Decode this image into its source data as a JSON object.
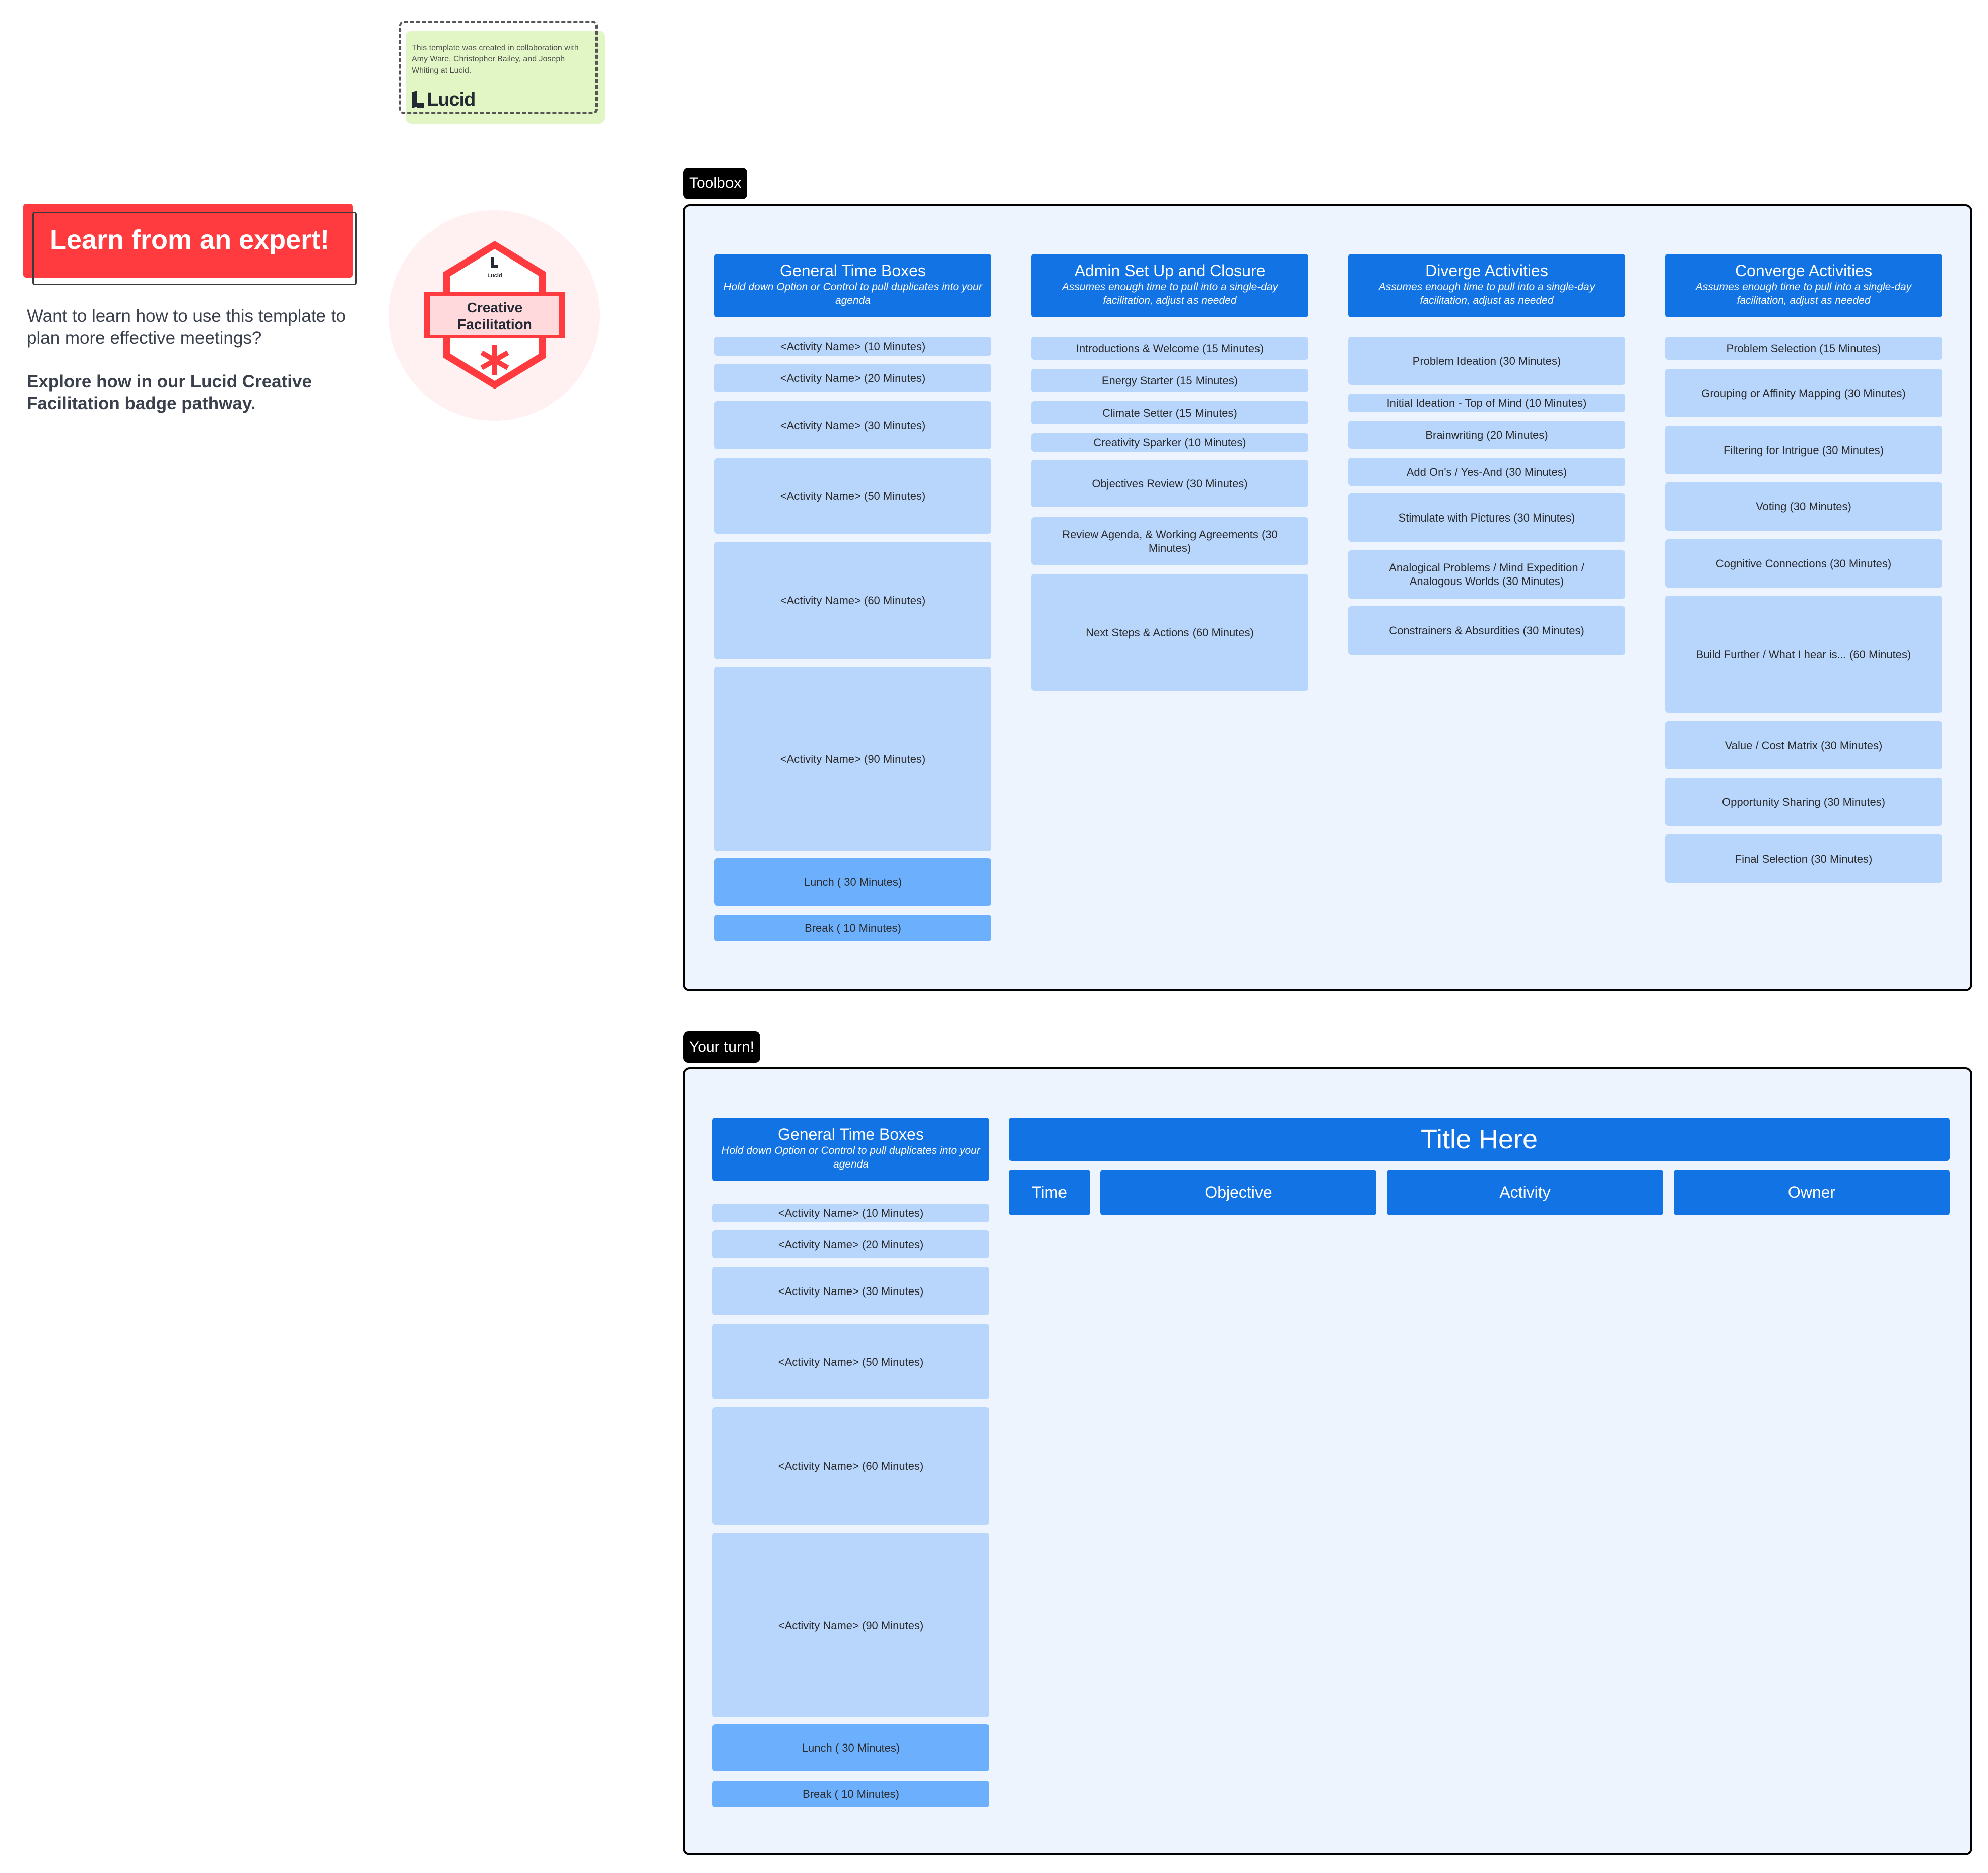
{
  "credit": {
    "text": "This template was created in collaboration with Amy Ware, Christopher Bailey, and Joseph Whiting at Lucid.",
    "logo_text": "Lucid"
  },
  "promo": {
    "button_label": "Learn from an expert!",
    "question": "Want to learn how to use this template to plan more effective meetings?",
    "cta": "Explore how in our Lucid Creative Facilitation badge pathway.",
    "accent_color": "#ff3b3f"
  },
  "badge": {
    "brand": "Lucid",
    "line1": "Creative",
    "line2": "Facilitation"
  },
  "toolbox": {
    "tag": "Toolbox",
    "columns": [
      {
        "title": "General Time Boxes",
        "subtitle": "Hold down Option or Control to pull duplicates into your agenda",
        "items": [
          "<Activity Name> (10 Minutes)",
          "<Activity Name> (20 Minutes)",
          "<Activity Name>  (30 Minutes)",
          "<Activity Name>  (50 Minutes)",
          "<Activity Name> (60 Minutes)",
          "<Activity Name> (90 Minutes)",
          "Lunch ( 30 Minutes)",
          "Break ( 10 Minutes)"
        ]
      },
      {
        "title": "Admin Set Up and Closure",
        "subtitle": "Assumes enough time to pull into a single-day facilitation, adjust as needed",
        "items": [
          "Introductions & Welcome (15 Minutes)",
          "Energy Starter (15 Minutes)",
          "Climate Setter (15 Minutes)",
          "Creativity Sparker (10 Minutes)",
          "Objectives Review (30 Minutes)",
          "Review Agenda, & Working Agreements (30 Minutes)",
          "Next Steps & Actions (60 Minutes)"
        ]
      },
      {
        "title": "Diverge Activities",
        "subtitle": "Assumes enough time to pull into a single-day facilitation, adjust as needed",
        "items": [
          "Problem Ideation (30 Minutes)",
          "Initial Ideation - Top of Mind (10 Minutes)",
          "Brainwriting (20 Minutes)",
          "Add On's / Yes-And (30 Minutes)",
          "Stimulate with Pictures (30 Minutes)",
          "Analogical Problems / Mind Expedition / Analogous Worlds (30 Minutes)",
          "Constrainers & Absurdities (30 Minutes)"
        ]
      },
      {
        "title": "Converge Activities",
        "subtitle": "Assumes enough time to pull into a single-day facilitation, adjust as needed",
        "items": [
          "Problem Selection (15 Minutes)",
          "Grouping or Affinity Mapping (30 Minutes)",
          "Filtering for Intrigue (30 Minutes)",
          "Voting (30 Minutes)",
          "Cognitive Connections (30 Minutes)",
          "Build Further / What I hear is... (60 Minutes)",
          "Value / Cost Matrix (30 Minutes)",
          "Opportunity Sharing (30 Minutes)",
          "Final Selection (30 Minutes)"
        ]
      }
    ]
  },
  "your_turn": {
    "tag": "Your turn!",
    "column": {
      "title": "General Time Boxes",
      "subtitle": "Hold down Option or Control to pull duplicates into your agenda",
      "items": [
        "<Activity Name> (10 Minutes)",
        "<Activity Name> (20 Minutes)",
        "<Activity Name>  (30 Minutes)",
        "<Activity Name>  (50 Minutes)",
        "<Activity Name> (60 Minutes)",
        "<Activity Name> (90 Minutes)",
        "Lunch ( 30 Minutes)",
        "Break ( 10 Minutes)"
      ]
    },
    "agenda": {
      "title": "Title Here",
      "columns": [
        "Time",
        "Objective",
        "Activity",
        "Owner"
      ]
    }
  },
  "colors": {
    "header_blue": "#1273e4",
    "block_light": "#b8d5fc",
    "block_dark": "#6cb0fd",
    "frame_bg": "#edf4fe"
  }
}
